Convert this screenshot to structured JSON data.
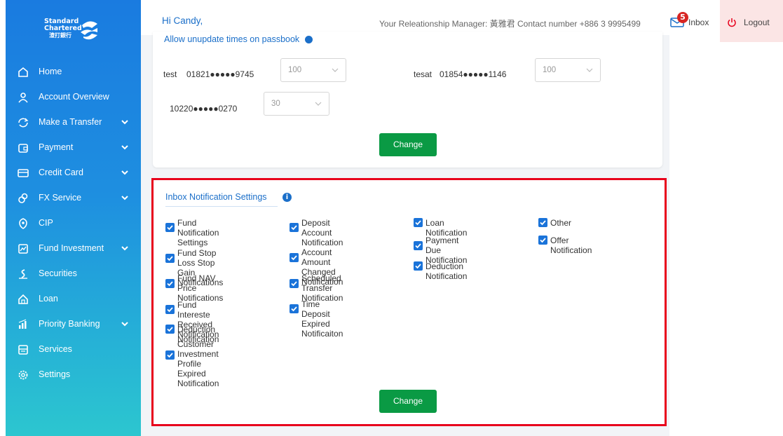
{
  "brand": {
    "logo_line1": "Standard",
    "logo_line2": "Chartered",
    "logo_line3": "渣打銀行",
    "colors": {
      "sidebar_top": "#1a7be0",
      "sidebar_bottom": "#2cc6cf",
      "accent_blue": "#1b6fc9",
      "button_green": "#0a9a44",
      "highlight_red": "#e8001c",
      "checkbox_blue": "#1a73d9"
    }
  },
  "sidebar": {
    "items": [
      {
        "label": "Home",
        "icon": "home-icon",
        "expandable": false
      },
      {
        "label": "Account Overview",
        "icon": "user-icon",
        "expandable": false
      },
      {
        "label": "Make a Transfer",
        "icon": "transfer-icon",
        "expandable": true
      },
      {
        "label": "Payment",
        "icon": "wallet-icon",
        "expandable": true
      },
      {
        "label": "Credit Card",
        "icon": "credit-card-icon",
        "expandable": true
      },
      {
        "label": "FX Service",
        "icon": "fx-icon",
        "expandable": true
      },
      {
        "label": "CIP",
        "icon": "shield-icon",
        "expandable": false
      },
      {
        "label": "Fund Investment",
        "icon": "chart-icon",
        "expandable": true
      },
      {
        "label": "Securities",
        "icon": "securities-icon",
        "expandable": false
      },
      {
        "label": "Loan",
        "icon": "loan-icon",
        "expandable": false
      },
      {
        "label": "Priority Banking",
        "icon": "bar-chart-icon",
        "expandable": true
      },
      {
        "label": "Services",
        "icon": "services-icon",
        "expandable": false
      },
      {
        "label": "Settings",
        "icon": "gear-icon",
        "expandable": false
      }
    ]
  },
  "header": {
    "greeting": "Hi Candy,",
    "rm_info": "Your Releationship Manager: 黃雅君 Contact number +886 3 9995499",
    "inbox_badge": "5",
    "inbox_label": "Inbox",
    "logout_label": "Logout"
  },
  "passbook": {
    "cut_title": "Allow unupdate times on passbook",
    "accounts": [
      {
        "name": "test",
        "number": "01821●●●●●9745",
        "value": "100"
      },
      {
        "name": "tesat",
        "number": "01854●●●●●1146",
        "value": "100"
      },
      {
        "name": "",
        "number": "10220●●●●●0270",
        "value": "30"
      }
    ],
    "change_label": "Change"
  },
  "inbox_settings": {
    "title": "Inbox Notification Settings",
    "columns": [
      [
        "Fund Notification\nSettings",
        "Fund Stop Loss Stop\nGain Notifications",
        "Fund NAV Price\nNotifications",
        "Fund Intereste Received\nNotification",
        "Deduction Notification",
        "Customer Investment\nProfile Expired\nNotification"
      ],
      [
        "Deposit Account\nNotification",
        "Account Amount\nChanged Notification",
        "Scheduled Transfer\nNotification",
        "Time Deposit Expired\nNotificaiton"
      ],
      [
        "Loan Notification",
        "Payment Due\nNotification",
        "Deduction Notification"
      ],
      [
        "Other",
        "Offer Notification"
      ]
    ],
    "change_label": "Change"
  }
}
